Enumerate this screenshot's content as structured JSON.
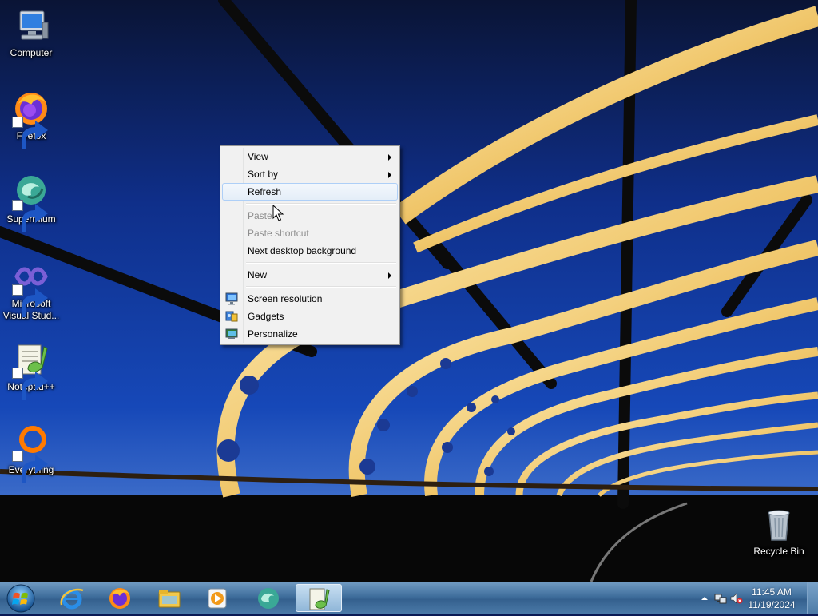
{
  "desktop": {
    "icons": [
      {
        "label": "Computer",
        "icon": "computer-icon"
      },
      {
        "label": "Firefox",
        "icon": "firefox-icon"
      },
      {
        "label": "Supermium",
        "icon": "supermium-icon"
      },
      {
        "label": "Microsoft Visual Stud...",
        "icon": "visual-studio-icon"
      },
      {
        "label": "Notepad++",
        "icon": "notepadpp-icon"
      },
      {
        "label": "Everything",
        "icon": "everything-icon"
      },
      {
        "label": "Recycle Bin",
        "icon": "recycle-bin-icon"
      }
    ]
  },
  "context_menu": {
    "items": [
      {
        "label": "View",
        "submenu": true
      },
      {
        "label": "Sort by",
        "submenu": true
      },
      {
        "label": "Refresh",
        "highlighted": true
      },
      {
        "label": "Paste",
        "disabled": true
      },
      {
        "label": "Paste shortcut",
        "disabled": true
      },
      {
        "label": "Next desktop background"
      },
      {
        "label": "New",
        "submenu": true
      },
      {
        "label": "Screen resolution",
        "icon": "screen-resolution-icon"
      },
      {
        "label": "Gadgets",
        "icon": "gadgets-icon"
      },
      {
        "label": "Personalize",
        "icon": "personalize-icon"
      }
    ]
  },
  "taskbar": {
    "pinned": [
      "internet-explorer-icon",
      "firefox-icon",
      "file-explorer-icon",
      "media-player-icon",
      "supermium-icon",
      "notepadpp-icon"
    ],
    "active": "notepadpp-icon"
  },
  "tray": {
    "time": "11:45 AM",
    "date": "11/19/2024",
    "icons": [
      "show-hidden-icons-icon",
      "network-icon",
      "volume-muted-icon"
    ]
  },
  "colors": {
    "menu_bg": "#f1f1f1",
    "menu_highlight": "#e4eef8",
    "taskbar": "#3f6e9c"
  }
}
